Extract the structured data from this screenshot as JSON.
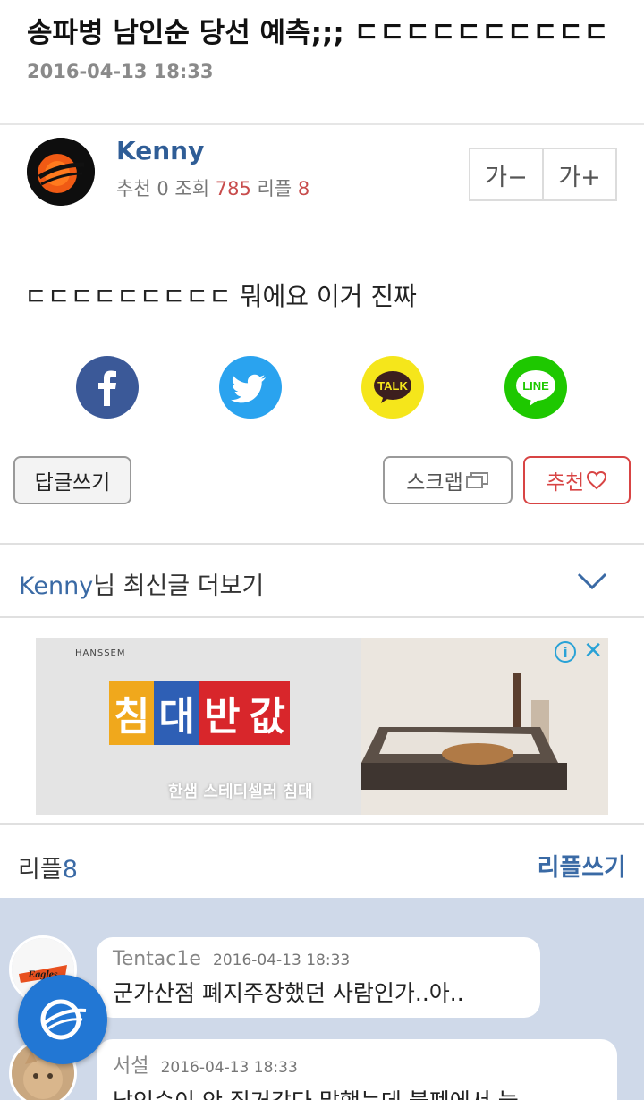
{
  "post": {
    "title": "송파병 남인순 당선 예측;;; ㄷㄷㄷㄷㄷㄷㄷㄷㄷㄷ",
    "date": "2016-04-13 18:33",
    "body": "ㄷㄷㄷㄷㄷㄷㄷㄷㄷ 뭐에요 이거 진짜"
  },
  "author": {
    "name": "Kenny",
    "stats": {
      "recommend_label": "추천",
      "recommend_count": "0",
      "views_label": "조회",
      "views_count": "785",
      "replies_label": "리플",
      "replies_count": "8"
    }
  },
  "font_controls": {
    "decrease": "가−",
    "increase": "가+"
  },
  "share": {
    "facebook_icon": "facebook-icon",
    "twitter_icon": "twitter-icon",
    "kakaotalk_label": "TALK",
    "line_label": "LINE"
  },
  "actions": {
    "reply": "답글쓰기",
    "scrap": "스크랩",
    "recommend": "추천"
  },
  "more_posts": {
    "name": "Kenny",
    "suffix": "님 최신글 더보기"
  },
  "ad": {
    "brand": "HANSSEM",
    "headline": [
      "침",
      "대",
      "반",
      "값"
    ],
    "headline_colors": [
      "#f0a81c",
      "#2e5fb5",
      "#d8262b",
      "#d8262b"
    ],
    "subtitle": "한샘 스테디셀러 침대",
    "info_label": "i",
    "close_label": "✕"
  },
  "replies": {
    "label": "리플",
    "count": "8",
    "write": "리플쓰기"
  },
  "comments": [
    {
      "name": "Tentac1e",
      "date": "2016-04-13 18:33",
      "text": "군가산점 폐지주장했던 사람인가..아.."
    },
    {
      "name": "서설",
      "date": "2016-04-13 18:33",
      "text": "남인순이 안 질거같다 말했는데 불펜에서 늘"
    }
  ],
  "colors": {
    "link_blue": "#2f5d96",
    "accent_red": "#d84444",
    "comment_bg": "#cfd9e9",
    "fab_blue": "#2277d4"
  }
}
